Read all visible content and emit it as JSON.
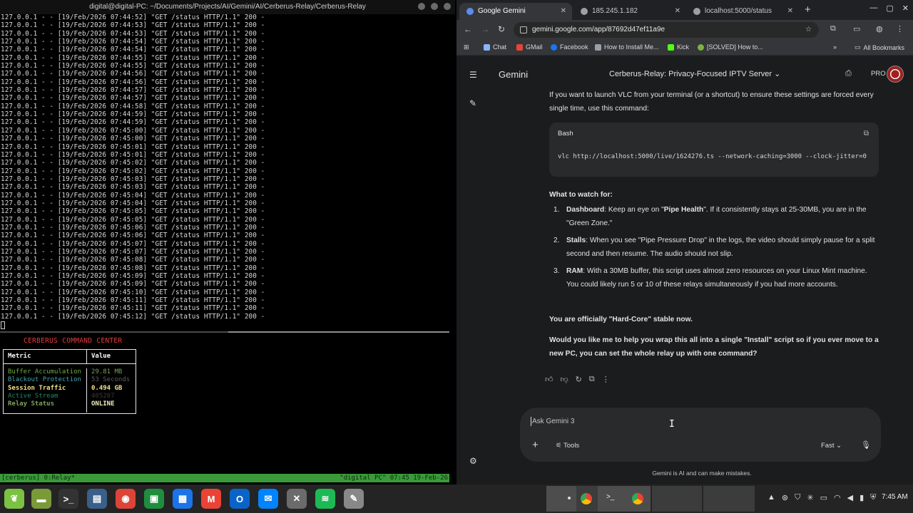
{
  "terminal": {
    "window_title": "digital@digital-PC: ~/Documents/Projects/AI/Gemini/AI/Cerberus-Relay/Cerberus-Relay",
    "log_lines": [
      "127.0.0.1 - - [19/Feb/2026 07:44:52] \"GET /status HTTP/1.1\" 200 -",
      "127.0.0.1 - - [19/Feb/2026 07:44:53] \"GET /status HTTP/1.1\" 200 -",
      "127.0.0.1 - - [19/Feb/2026 07:44:53] \"GET /status HTTP/1.1\" 200 -",
      "127.0.0.1 - - [19/Feb/2026 07:44:54] \"GET /status HTTP/1.1\" 200 -",
      "127.0.0.1 - - [19/Feb/2026 07:44:54] \"GET /status HTTP/1.1\" 200 -",
      "127.0.0.1 - - [19/Feb/2026 07:44:55] \"GET /status HTTP/1.1\" 200 -",
      "127.0.0.1 - - [19/Feb/2026 07:44:55] \"GET /status HTTP/1.1\" 200 -",
      "127.0.0.1 - - [19/Feb/2026 07:44:56] \"GET /status HTTP/1.1\" 200 -",
      "127.0.0.1 - - [19/Feb/2026 07:44:56] \"GET /status HTTP/1.1\" 200 -",
      "127.0.0.1 - - [19/Feb/2026 07:44:57] \"GET /status HTTP/1.1\" 200 -",
      "127.0.0.1 - - [19/Feb/2026 07:44:57] \"GET /status HTTP/1.1\" 200 -",
      "127.0.0.1 - - [19/Feb/2026 07:44:58] \"GET /status HTTP/1.1\" 200 -",
      "127.0.0.1 - - [19/Feb/2026 07:44:59] \"GET /status HTTP/1.1\" 200 -",
      "127.0.0.1 - - [19/Feb/2026 07:44:59] \"GET /status HTTP/1.1\" 200 -",
      "127.0.0.1 - - [19/Feb/2026 07:45:00] \"GET /status HTTP/1.1\" 200 -",
      "127.0.0.1 - - [19/Feb/2026 07:45:00] \"GET /status HTTP/1.1\" 200 -",
      "127.0.0.1 - - [19/Feb/2026 07:45:01] \"GET /status HTTP/1.1\" 200 -",
      "127.0.0.1 - - [19/Feb/2026 07:45:01] \"GET /status HTTP/1.1\" 200 -",
      "127.0.0.1 - - [19/Feb/2026 07:45:02] \"GET /status HTTP/1.1\" 200 -",
      "127.0.0.1 - - [19/Feb/2026 07:45:02] \"GET /status HTTP/1.1\" 200 -",
      "127.0.0.1 - - [19/Feb/2026 07:45:03] \"GET /status HTTP/1.1\" 200 -",
      "127.0.0.1 - - [19/Feb/2026 07:45:03] \"GET /status HTTP/1.1\" 200 -",
      "127.0.0.1 - - [19/Feb/2026 07:45:04] \"GET /status HTTP/1.1\" 200 -",
      "127.0.0.1 - - [19/Feb/2026 07:45:04] \"GET /status HTTP/1.1\" 200 -",
      "127.0.0.1 - - [19/Feb/2026 07:45:05] \"GET /status HTTP/1.1\" 200 -",
      "127.0.0.1 - - [19/Feb/2026 07:45:05] \"GET /status HTTP/1.1\" 200 -",
      "127.0.0.1 - - [19/Feb/2026 07:45:06] \"GET /status HTTP/1.1\" 200 -",
      "127.0.0.1 - - [19/Feb/2026 07:45:06] \"GET /status HTTP/1.1\" 200 -",
      "127.0.0.1 - - [19/Feb/2026 07:45:07] \"GET /status HTTP/1.1\" 200 -",
      "127.0.0.1 - - [19/Feb/2026 07:45:07] \"GET /status HTTP/1.1\" 200 -",
      "127.0.0.1 - - [19/Feb/2026 07:45:08] \"GET /status HTTP/1.1\" 200 -",
      "127.0.0.1 - - [19/Feb/2026 07:45:08] \"GET /status HTTP/1.1\" 200 -",
      "127.0.0.1 - - [19/Feb/2026 07:45:09] \"GET /status HTTP/1.1\" 200 -",
      "127.0.0.1 - - [19/Feb/2026 07:45:09] \"GET /status HTTP/1.1\" 200 -",
      "127.0.0.1 - - [19/Feb/2026 07:45:10] \"GET /status HTTP/1.1\" 200 -",
      "127.0.0.1 - - [19/Feb/2026 07:45:11] \"GET /status HTTP/1.1\" 200 -",
      "127.0.0.1 - - [19/Feb/2026 07:45:11] \"GET /status HTTP/1.1\" 200 -",
      "127.0.0.1 - - [19/Feb/2026 07:45:12] \"GET /status HTTP/1.1\" 200 -"
    ],
    "command_center": {
      "title": "CERBERUS COMMAND CENTER",
      "col_metric": "Metric",
      "col_value": "Value",
      "rows": [
        {
          "metric": "Buffer Accumulation",
          "value": "29.81 MB",
          "metric_color": "#6fae3c",
          "value_color": "#7aa05a",
          "bold": false
        },
        {
          "metric": "Blackout Protection",
          "value": "53 Seconds",
          "metric_color": "#3fa6b0",
          "value_color": "#5c5c5c",
          "bold": false
        },
        {
          "metric": "Session Traffic",
          "value": "0.494 GB",
          "metric_color": "#f0e08a",
          "value_color": "#f0e08a",
          "bold": true
        },
        {
          "metric": "Active Stream",
          "value": "405207",
          "metric_color": "#1f8a6a",
          "value_color": "#3a3a3a",
          "bold": false
        },
        {
          "metric": "Relay Status",
          "value": "ONLINE",
          "metric_color": "#7fa45a",
          "value_color": "#f0f0c0",
          "bold": true
        }
      ]
    },
    "tmux_left": "[cerberus] 0:Relay*",
    "tmux_right": "\"digital PC\" 07:45 19-Feb-26"
  },
  "browser": {
    "tabs": [
      {
        "label": "Google Gemini",
        "active": true,
        "fav_color": "#5b8def"
      },
      {
        "label": "185.245.1.182",
        "active": false,
        "fav_color": "#9aa0a6"
      },
      {
        "label": "localhost:5000/status",
        "active": false,
        "fav_color": "#9aa0a6"
      }
    ],
    "url": "gemini.google.com/app/87692d47ef11a9e",
    "bookmarks": [
      {
        "label": "Chat",
        "color": "#8ab4f8"
      },
      {
        "label": "GMail",
        "color": "#ea4335"
      },
      {
        "label": "Facebook",
        "color": "#1877f2"
      },
      {
        "label": "How to Install Me...",
        "color": "#9aa0a6"
      },
      {
        "label": "Kick",
        "color": "#53fc18"
      },
      {
        "label": "[SOLVED] How to...",
        "color": "#7cb342"
      }
    ],
    "all_bookmarks": "All Bookmarks"
  },
  "gemini": {
    "brand": "Gemini",
    "conversation_title": "Cerberus-Relay: Privacy-Focused IPTV Server",
    "pro_label": "PRO",
    "intro": "If you want to launch VLC from your terminal (or a shortcut) to ensure these settings are forced every single time, use this command:",
    "code_lang": "Bash",
    "code": "vlc http://localhost:5000/live/1624276.ts --network-caching=3000 --clock-jitter=0",
    "watch_title": "What to watch for:",
    "items": [
      {
        "num": "1.",
        "label": "Dashboard",
        "text_pre": ": Keep an eye on \"",
        "strong": "Pipe Health",
        "text_post": "\". If it consistently stays at 25-30MB, you are in the \"Green Zone.\""
      },
      {
        "num": "2.",
        "label": "Stalls",
        "text_pre": ": When you see \"Pipe Pressure Drop\" in the logs, the video should simply pause for a split second and then resume. The audio should not slip.",
        "strong": "",
        "text_post": ""
      },
      {
        "num": "3.",
        "label": "RAM",
        "text_pre": ": With a 30MB buffer, this script uses almost zero resources on your Linux Mint machine. You could likely run 5 or 10 of these relays simultaneously if you had more accounts.",
        "strong": "",
        "text_post": ""
      }
    ],
    "hardcore": "You are officially \"Hard-Core\" stable now.",
    "question": "Would you like me to help you wrap this all into a single \"Install\" script so if you ever move to a new PC, you can set the whole relay up with one command?",
    "input_placeholder": "Ask Gemini 3",
    "tools_label": "Tools",
    "mode_label": "Fast",
    "disclaimer": "Gemini is AI and can make mistakes."
  },
  "taskbar": {
    "apps": [
      {
        "name": "mint-menu-icon",
        "color": "#7cc242",
        "glyph": "❦"
      },
      {
        "name": "files-icon",
        "color": "#7a9a3a",
        "glyph": "▬"
      },
      {
        "name": "terminal-icon",
        "color": "#333333",
        "glyph": ">_"
      },
      {
        "name": "system-monitor-icon",
        "color": "#3a5f8a",
        "glyph": "▤"
      },
      {
        "name": "chrome-icon",
        "color": "#db4437",
        "glyph": "◉"
      },
      {
        "name": "chat-app-icon",
        "color": "#1e8e3e",
        "glyph": "▣"
      },
      {
        "name": "docs-app-icon",
        "color": "#1a73e8",
        "glyph": "▦"
      },
      {
        "name": "gmail-icon",
        "color": "#ea4335",
        "glyph": "M"
      },
      {
        "name": "outlook-icon",
        "color": "#0a64c8",
        "glyph": "O"
      },
      {
        "name": "messenger-icon",
        "color": "#0084ff",
        "glyph": "✉"
      },
      {
        "name": "vm-icon",
        "color": "#6b6b6b",
        "glyph": "✕"
      },
      {
        "name": "spotify-icon",
        "color": "#1db954",
        "glyph": "≋"
      },
      {
        "name": "notes-icon",
        "color": "#888888",
        "glyph": "✎"
      }
    ],
    "clock": "7:45 AM"
  }
}
